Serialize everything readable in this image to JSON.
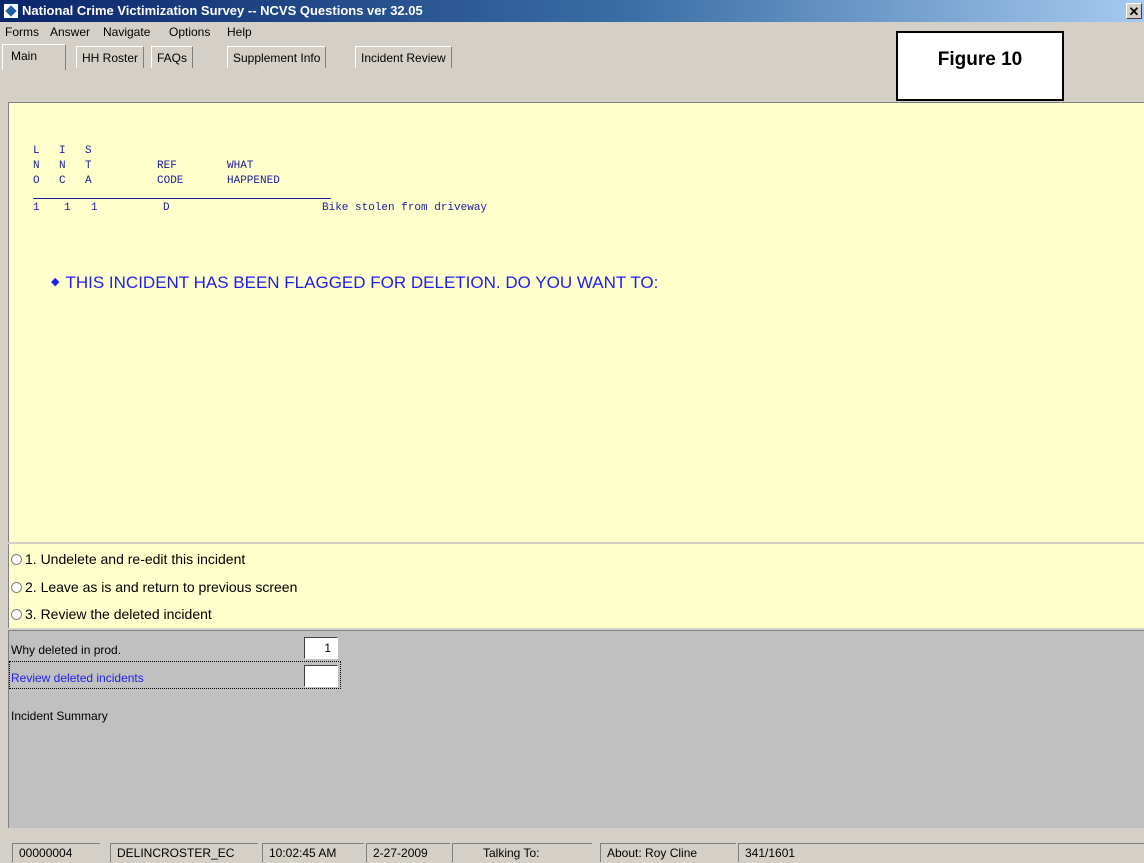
{
  "window": {
    "title": "National Crime Victimization Survey -- NCVS Questions ver 32.05",
    "close_glyph": "✕"
  },
  "menu": [
    "Forms",
    "Answer",
    "Navigate",
    "Options",
    "Help"
  ],
  "tabs": [
    "Main",
    "HH Roster",
    "FAQs",
    "Supplement Info",
    "Incident Review"
  ],
  "figure_label": "Figure 10",
  "roster": {
    "headers_line1": [
      "L",
      "I",
      "S",
      "",
      ""
    ],
    "headers_line2": [
      "N",
      "N",
      "T",
      "REF",
      "WHAT"
    ],
    "headers_line3": [
      "O",
      "C",
      "A",
      "CODE",
      "HAPPENED"
    ],
    "row": [
      "1",
      "1",
      "1",
      "D",
      "Bike stolen from driveway"
    ]
  },
  "question": {
    "bullet": "◆",
    "text": "THIS INCIDENT HAS BEEN FLAGGED FOR DELETION. DO YOU WANT TO:"
  },
  "options": [
    "1. Undelete and re-edit this incident",
    "2. Leave as is and return to previous screen",
    "3. Review the deleted incident"
  ],
  "fields": [
    {
      "label": "Why deleted in prod.",
      "value": "1"
    },
    {
      "label": "Review deleted incidents",
      "value": ""
    },
    {
      "label": "Incident Summary"
    }
  ],
  "status": {
    "case_id": "00000004",
    "screen": "DELINCROSTER_EC",
    "time": "10:02:45 AM",
    "date": "2-27-2009",
    "talking_to": "Talking To:",
    "about": "About:  Roy Cline",
    "position": "341/1601"
  }
}
